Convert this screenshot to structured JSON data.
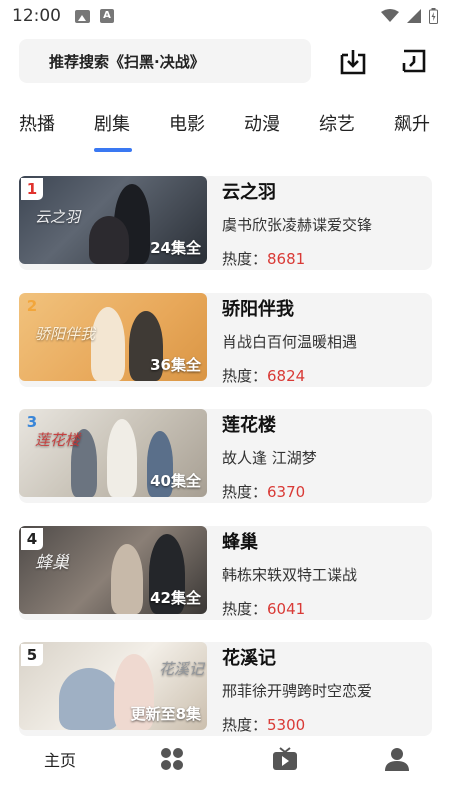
{
  "status_bar": {
    "time": "12:00"
  },
  "search": {
    "placeholder_text": "推荐搜索《扫黑·决战》"
  },
  "tabs": [
    {
      "label": "热播"
    },
    {
      "label": "剧集"
    },
    {
      "label": "电影"
    },
    {
      "label": "动漫"
    },
    {
      "label": "综艺"
    },
    {
      "label": "飙升"
    }
  ],
  "active_tab": "剧集",
  "heat_label": "热度：",
  "shows": [
    {
      "rank": "1",
      "rank_color": "#e0322d",
      "title": "云之羽",
      "cast": "虞书欣张凌赫谍爱交锋",
      "heat": "8681",
      "episodes": "24集全",
      "poster_text": "云之羽"
    },
    {
      "rank": "2",
      "rank_color": "#f2a63b",
      "title": "骄阳伴我",
      "cast": "肖战白百何温暖相遇",
      "heat": "6824",
      "episodes": "36集全",
      "poster_text": "骄阳伴我"
    },
    {
      "rank": "3",
      "rank_color": "#3a86d8",
      "title": "莲花楼",
      "cast": "故人逢 江湖梦",
      "heat": "6370",
      "episodes": "40集全",
      "poster_text": "莲花楼"
    },
    {
      "rank": "4",
      "rank_color": "#222222",
      "title": "蜂巢",
      "cast": "韩栋宋轶双特工谍战",
      "heat": "6041",
      "episodes": "42集全",
      "poster_text": "蜂巢"
    },
    {
      "rank": "5",
      "rank_color": "#222222",
      "title": "花溪记",
      "cast": "邢菲徐开骋跨时空恋爱",
      "heat": "5300",
      "episodes": "更新至8集",
      "poster_text": "花溪记"
    }
  ],
  "bottom_nav": {
    "home_label": "主页"
  },
  "colors": {
    "accent": "#3a78f2",
    "heat_value": "#d93a36"
  }
}
